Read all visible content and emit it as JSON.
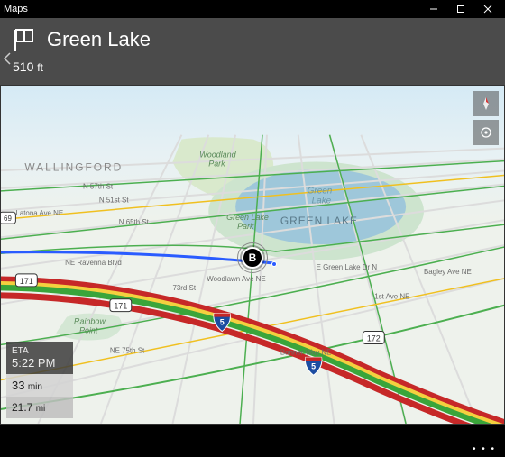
{
  "window": {
    "title": "Maps"
  },
  "nav": {
    "destination": "Green Lake",
    "distance_value": "510",
    "distance_unit": "ft"
  },
  "eta": {
    "eta_label": "ETA",
    "eta_value": "5:22 PM",
    "duration_value": "33",
    "duration_unit": "min",
    "distance_value": "21.7",
    "distance_unit": "mi"
  },
  "destination_marker": {
    "letter": "B"
  },
  "map_labels": {
    "district": "WALLINGFORD",
    "lake_name_italic": "Green\nLake",
    "lake_name_caps": "GREEN LAKE",
    "woodland_park": "Woodland\nPark",
    "green_lake_park": "Green Lake\nPark",
    "rainbow_point": "Rainbow\nPoint",
    "streets": {
      "n57": "N 57th St",
      "n51": "N 51st St",
      "n65": "N 65th St",
      "n73": "73rd St",
      "latona": "Latona Ave NE",
      "ravenna": "NE Ravenna Blvd",
      "woodlawn": "Woodlawn Ave NE",
      "e_green_lake": "E Green Lake Dr N",
      "bagley": "Bagley Ave NE",
      "first_ne": "1st Ave NE",
      "banner": "Banner Way NE",
      "ne75": "NE 75th St"
    },
    "highways": {
      "i5": "5",
      "r171": "171",
      "r172": "172",
      "r69": "69"
    }
  }
}
